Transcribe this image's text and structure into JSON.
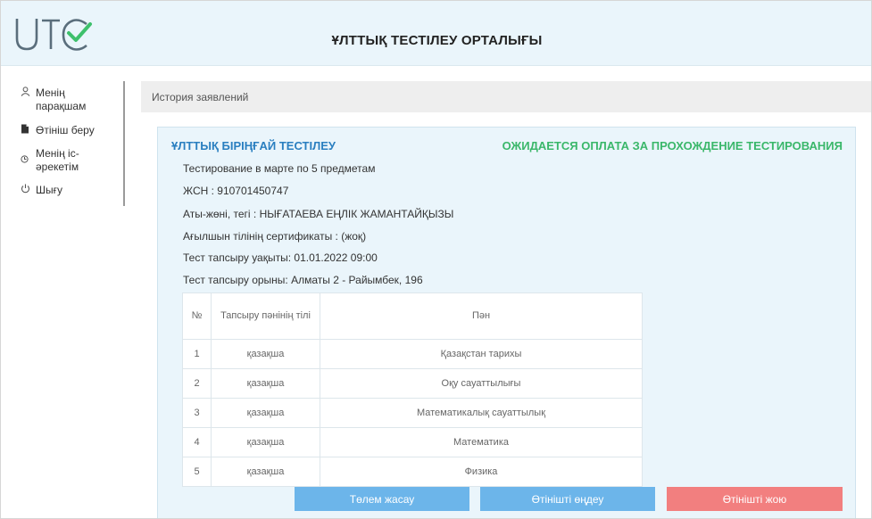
{
  "header": {
    "logo_text": "UTC",
    "title": "ҰЛТТЫҚ ТЕСТІЛЕУ ОРТАЛЫҒЫ"
  },
  "sidebar": {
    "items": [
      {
        "icon": "user-icon",
        "label": "Менің парақшам"
      },
      {
        "icon": "document-icon",
        "label": "Өтініш беру"
      },
      {
        "icon": "activity-icon",
        "label": "Менің іс-әрекетім"
      },
      {
        "icon": "power-icon",
        "label": "Шығу"
      }
    ]
  },
  "breadcrumb": "История заявлений",
  "application": {
    "title": "ҰЛТТЫҚ БІРІҢҒАЙ ТЕСТІЛЕУ",
    "status": "ОЖИДАЕТСЯ ОПЛАТА ЗА ПРОХОЖДЕНИЕ ТЕСТИРОВАНИЯ",
    "status_color": "#3ab76a",
    "title_color": "#2a7fc0",
    "info": [
      "Тестирование в марте по 5 предметам",
      "ЖСН : 910701450747",
      "Аты-жөні, тегі : НЫҒАТАЕВА ЕҢЛІК ЖАМАНТАЙҚЫЗЫ",
      "Ағылшын тілінің сертификаты : (жоқ)",
      "Тест тапсыру уақыты: 01.01.2022 09:00",
      "Тест тапсыру орыны: Алматы 2 - Райымбек, 196"
    ],
    "table": {
      "headers": [
        "№",
        "Тапсыру пәнінің тілі",
        "Пән"
      ],
      "rows": [
        [
          "1",
          "қазақша",
          "Қазақстан тарихы"
        ],
        [
          "2",
          "қазақша",
          "Оқу сауаттылығы"
        ],
        [
          "3",
          "қазақша",
          "Математикалық сауаттылық"
        ],
        [
          "4",
          "қазақша",
          "Математика"
        ],
        [
          "5",
          "қазақша",
          "Физика"
        ]
      ]
    }
  },
  "actions": {
    "pay": "Төлем жасау",
    "edit": "Өтінішті өңдеу",
    "delete": "Өтінішті жою"
  }
}
